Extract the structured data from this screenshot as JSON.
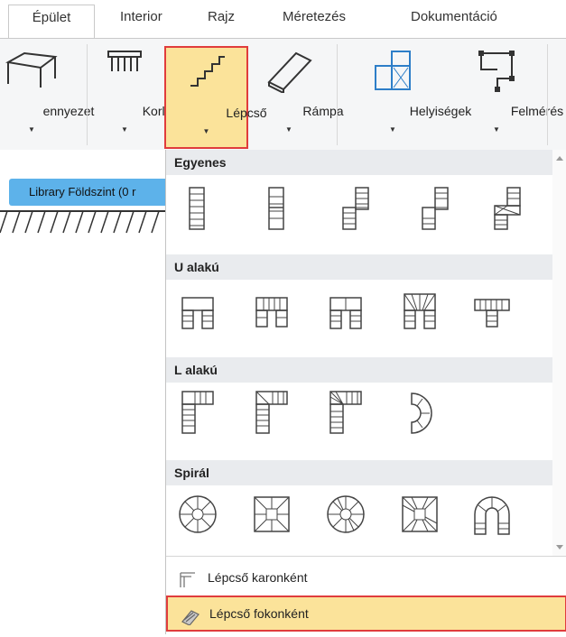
{
  "tabs": [
    "Épület",
    "Interior",
    "Rajz",
    "Méretezés",
    "Dokumentáció"
  ],
  "ribbon": {
    "buttons": [
      {
        "label": "ennyezet",
        "icon": "ceiling-icon"
      },
      {
        "label": "Korlát",
        "icon": "railing-icon"
      },
      {
        "label": "Lépcső",
        "icon": "stair-icon"
      },
      {
        "label": "Rámpa",
        "icon": "ramp-icon"
      },
      {
        "label": "Helyiségek",
        "icon": "rooms-icon"
      },
      {
        "label": "Felmérés",
        "icon": "survey-icon"
      }
    ]
  },
  "layer": {
    "label": "Library Földszint (0 r"
  },
  "dropdown": {
    "categories": [
      "Egyenes",
      "U alakú",
      "L alakú",
      "Spirál"
    ],
    "commands": [
      "Lépcső karonként",
      "Lépcső fokonként"
    ]
  }
}
